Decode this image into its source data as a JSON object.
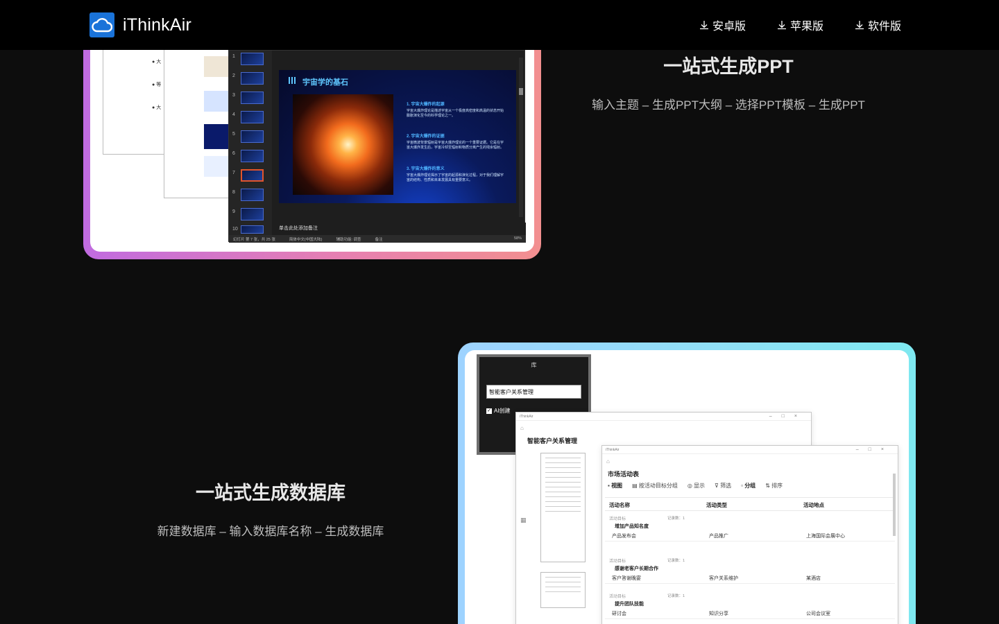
{
  "header": {
    "brand": "iThinkAir",
    "nav": [
      "安卓版",
      "苹果版",
      "软件版"
    ]
  },
  "feature_ppt": {
    "title": "一站式生成PPT",
    "desc": "输入主题 – 生成PPT大纲 – 选择PPT模板 – 生成PPT"
  },
  "feature_db": {
    "title": "一站式生成数据库",
    "desc": "新建数据库 – 输入数据库名称 – 生成数据库"
  },
  "ppt_mock": {
    "doc_bullets": [
      "大",
      "等",
      "大"
    ],
    "thumb_numbers": [
      "1",
      "2",
      "3",
      "4",
      "5",
      "6",
      "7",
      "8",
      "9",
      "10"
    ],
    "slide_title": "宇宙学的基石",
    "points": [
      {
        "head": "1. 宇宙大爆炸的起源",
        "body": "宇宙大爆炸理论是描述宇宙从一个极度高密度和高温的状态开始膨胀演化至今的科学理论之一。"
      },
      {
        "head": "2. 宇宙大爆炸的证据",
        "body": "宇宙微波背景辐射是宇宙大爆炸理论的一个重要证据。它是在宇宙大爆炸发生后，宇宙冷却至辐射和物质分离产生的残余辐射。"
      },
      {
        "head": "3. 宇宙大爆炸的意义",
        "body": "宇宙大爆炸理论揭示了宇宙的起源和演化过程，对于我们理解宇宙的结构、性质和未来发展具有重要意义。"
      }
    ],
    "notes": "单击此处添加备注",
    "status": [
      "幻灯片 第 7 张，共 25 张",
      "简体中文(中国大陆)",
      "辅助功能: 调查",
      "备注",
      "58%"
    ]
  },
  "db_mock": {
    "dialog_title": "库",
    "dialog_input": "智能客户关系管理",
    "dialog_check": "AI创建",
    "win_brand": "iThinkAir",
    "win1_title": "智能客户关系管理",
    "win2_title": "市场活动表",
    "toolbar": [
      "视图",
      "按活动目标分组",
      "显示",
      "筛选",
      "分组",
      "排序"
    ],
    "columns": [
      "活动名称",
      "活动类型",
      "活动地点"
    ],
    "groups": [
      {
        "label": "活动目标",
        "name": "增加产品知名度",
        "count": "记录数：1",
        "row": [
          "产品发布会",
          "产品推广",
          "上海国际会展中心"
        ]
      },
      {
        "label": "活动目标",
        "name": "感谢老客户长期合作",
        "count": "记录数：1",
        "row": [
          "客户答谢晚宴",
          "客户关系维护",
          "某酒店"
        ]
      },
      {
        "label": "活动目标",
        "name": "提升团队技能",
        "count": "记录数：1",
        "row": [
          "研讨会",
          "知识分享",
          "公司会议室"
        ]
      }
    ]
  }
}
